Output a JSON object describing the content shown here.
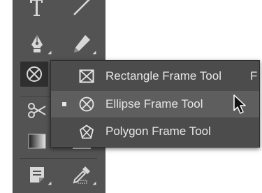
{
  "toolbar": {
    "tools": [
      {
        "name": "type-tool",
        "icon": "type-icon"
      },
      {
        "name": "line-tool",
        "icon": "line-icon"
      },
      {
        "name": "pen-tool",
        "icon": "pen-icon"
      },
      {
        "name": "pencil-tool",
        "icon": "pencil-icon"
      },
      {
        "name": "frame-tool",
        "icon": "ellipse-frame-icon",
        "active": true
      },
      {
        "name": "scissors-tool",
        "icon": "scissors-icon"
      },
      {
        "name": "gradient-swatch-tool",
        "icon": "gradient-icon"
      },
      {
        "name": "gradient-feather-tool",
        "icon": "gradient-feather-icon"
      },
      {
        "name": "note-tool",
        "icon": "note-icon"
      },
      {
        "name": "eyedropper-tool",
        "icon": "eyedropper-icon"
      }
    ]
  },
  "flyout": {
    "items": [
      {
        "label": "Rectangle Frame Tool",
        "shortcut": "F",
        "icon": "rectangle-frame-icon",
        "selected": false,
        "highlighted": false
      },
      {
        "label": "Ellipse Frame Tool",
        "shortcut": "",
        "icon": "ellipse-frame-icon",
        "selected": true,
        "highlighted": true
      },
      {
        "label": "Polygon Frame Tool",
        "shortcut": "",
        "icon": "polygon-frame-icon",
        "selected": false,
        "highlighted": false
      }
    ]
  },
  "colors": {
    "toolbar_bg": "#535353",
    "flyout_bg": "#4c4c4c",
    "highlight_bg": "#5e5e5e",
    "text": "#e6e6e6"
  }
}
